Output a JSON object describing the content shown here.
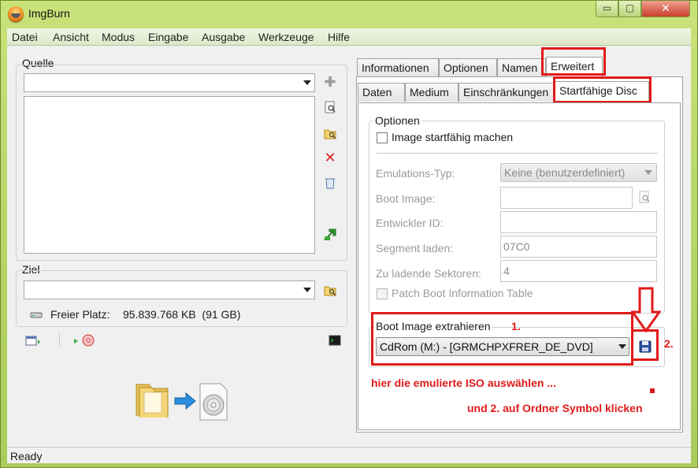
{
  "window": {
    "title": "ImgBurn",
    "controls": {
      "minimize": "▭",
      "maximize": "▢",
      "close": "✕"
    }
  },
  "menu": [
    "Datei",
    "Ansicht",
    "Modus",
    "Eingabe",
    "Ausgabe",
    "Werkzeuge",
    "Hilfe"
  ],
  "source": {
    "label": "Quelle",
    "combo_value": "",
    "list_items": []
  },
  "destination": {
    "label": "Ziel",
    "combo_value": "",
    "free_space_label": "Freier Platz:",
    "free_space_value": "95.839.768 KB  (91 GB)"
  },
  "main_tabs": [
    "Informationen",
    "Optionen",
    "Namen",
    "Erweitert"
  ],
  "sub_tabs": [
    "Daten",
    "Medium",
    "Einschränkungen",
    "Startfähige Disc"
  ],
  "options_group": {
    "title": "Optionen",
    "make_bootable_label": "Image startfähig machen",
    "make_bootable_checked": false,
    "emulation_label": "Emulations-Typ:",
    "emulation_value": "Keine (benutzerdefiniert)",
    "boot_image_label": "Boot Image:",
    "boot_image_value": "",
    "developer_id_label": "Entwickler ID:",
    "developer_id_value": "",
    "load_segment_label": "Segment laden:",
    "load_segment_value": "07C0",
    "sectors_label": "Zu ladende Sektoren:",
    "sectors_value": "4",
    "patch_label": "Patch Boot Information Table",
    "patch_checked": false
  },
  "extract_group": {
    "title": "Boot Image extrahieren",
    "drive_value": "CdRom (M:) - [GRMCHPXFRER_DE_DVD]"
  },
  "annotations": {
    "step1": "1.",
    "step2": "2.",
    "hint1": "hier die emulierte ISO auswählen ...",
    "hint2": "und 2. auf Ordner Symbol klicken"
  },
  "status": "Ready",
  "colors": {
    "highlight": "#e01a1a",
    "window_frame": "#b9d86a"
  }
}
